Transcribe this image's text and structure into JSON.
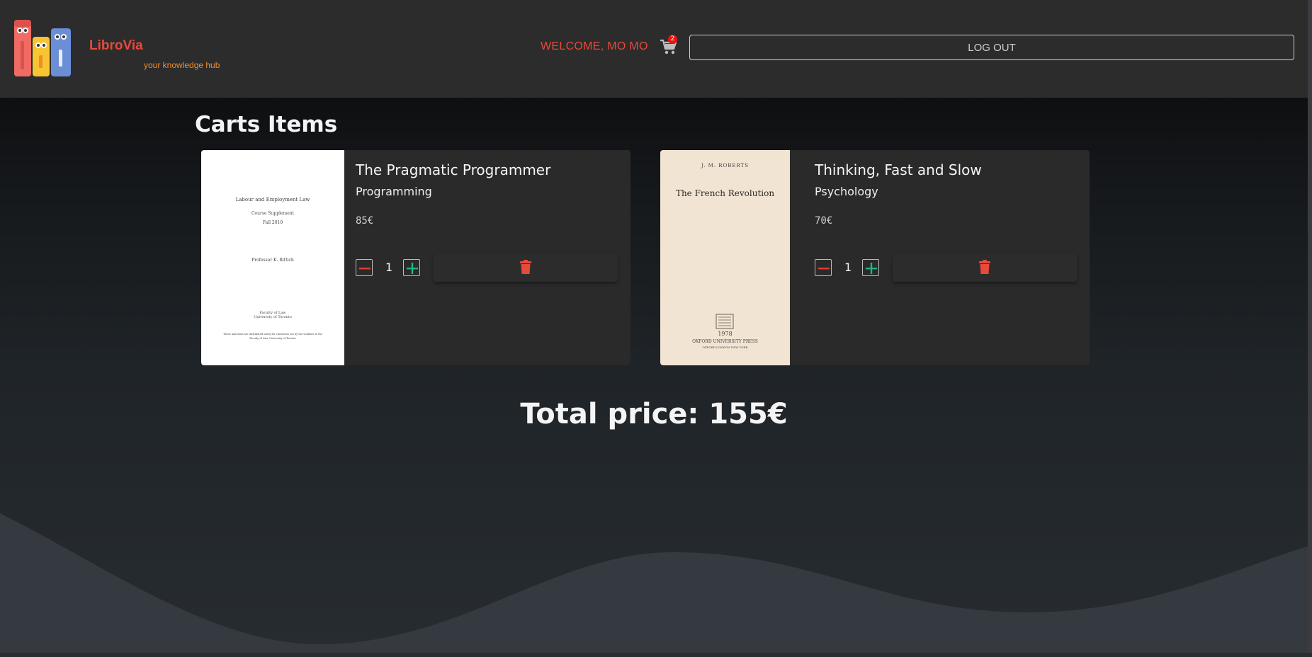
{
  "header": {
    "brand_name": "LibroVia",
    "brand_tagline": "your knowledge hub",
    "welcome": "WELCOME, MO MO",
    "cart_count": "2",
    "logout_label": "LOG OUT"
  },
  "page_title": "Carts Items",
  "cart": {
    "items": [
      {
        "title": "The Pragmatic Programmer",
        "category": "Programming",
        "price": "85€",
        "quantity": "1",
        "cover": {
          "line1": "Labour and Employment Law",
          "line2": "Course Supplement",
          "line3": "Fall 2010",
          "line4": "Professor K. Rittich",
          "line5": "Faculty of Law",
          "line6": "University of Toronto",
          "line7": "These materials are distributed solely for classroom use by the students in the",
          "line8": "Faculty of Law, University of Toronto"
        }
      },
      {
        "title": "Thinking, Fast and Slow",
        "category": "Psychology",
        "price": "70€",
        "quantity": "1",
        "cover": {
          "author": "J. M. ROBERTS",
          "title": "The French Revolution",
          "year": "1978",
          "publisher": "OXFORD UNIVERSITY PRESS",
          "cities": "OXFORD   LONDON   NEW YORK"
        }
      }
    ]
  },
  "total_label": "Total price: 155€",
  "colors": {
    "brand_red": "#e64a3b",
    "tagline_orange": "#f08b2e",
    "minus_red": "#e23b2e",
    "plus_green": "#1db884",
    "badge_red": "#e8140f"
  },
  "icons": {
    "cart": "cart-icon",
    "trash": "trash-icon",
    "minus": "minus-icon",
    "plus": "plus-icon"
  }
}
